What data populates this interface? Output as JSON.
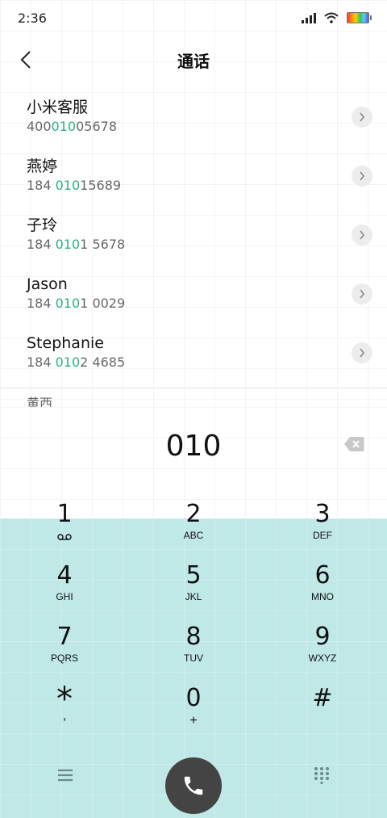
{
  "status": {
    "time": "2:36"
  },
  "nav": {
    "title": "通话"
  },
  "contacts": [
    {
      "name": "小米客服",
      "number_parts": [
        "400",
        "010",
        "05678"
      ]
    },
    {
      "name": "燕婷",
      "number_parts": [
        "184 ",
        "010",
        "15689"
      ]
    },
    {
      "name": "子玲",
      "number_parts": [
        "184 ",
        "010",
        "1 5678"
      ]
    },
    {
      "name": "Jason",
      "number_parts": [
        "184 ",
        "010",
        "1 0029"
      ]
    },
    {
      "name": "Stephanie",
      "number_parts": [
        "184 ",
        "010",
        "2 4685"
      ]
    }
  ],
  "next_contact_peek": "黄西",
  "dial_input": "010",
  "keys": [
    {
      "digit": "1",
      "letters": ""
    },
    {
      "digit": "2",
      "letters": "ABC"
    },
    {
      "digit": "3",
      "letters": "DEF"
    },
    {
      "digit": "4",
      "letters": "GHI"
    },
    {
      "digit": "5",
      "letters": "JKL"
    },
    {
      "digit": "6",
      "letters": "MNO"
    },
    {
      "digit": "7",
      "letters": "PQRS"
    },
    {
      "digit": "8",
      "letters": "TUV"
    },
    {
      "digit": "9",
      "letters": "WXYZ"
    },
    {
      "digit": "*",
      "letters": ","
    },
    {
      "digit": "0",
      "letters": "+"
    },
    {
      "digit": "#",
      "letters": ""
    }
  ],
  "colors": {
    "highlight": "#27b37a",
    "keypad_bg": "#bfe8e6",
    "call_button": "#444444"
  },
  "icons": [
    "back-arrow-icon",
    "chevron-right-icon",
    "backspace-icon",
    "voicemail-icon",
    "menu-icon",
    "phone-icon",
    "dialpad-icon"
  ]
}
